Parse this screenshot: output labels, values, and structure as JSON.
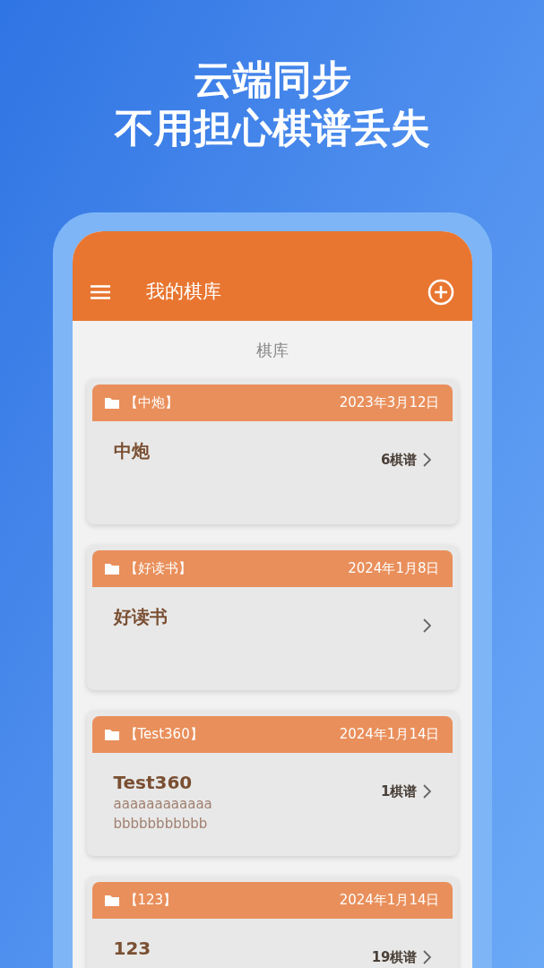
{
  "headline": [
    "云端同步",
    "不用担心棋谱丢失"
  ],
  "app_bar": {
    "title": "我的棋库"
  },
  "section_title": "棋库",
  "folders": [
    {
      "tag": "【中炮】",
      "date": "2023年3月12日",
      "name": "中炮",
      "count": "6棋谱"
    },
    {
      "tag": "【好读书】",
      "date": "2024年1月8日",
      "name": "好读书"
    },
    {
      "tag": "【Test360】",
      "date": "2024年1月14日",
      "name": "Test360",
      "description": [
        "aaaaaaaaaaaa",
        "bbbbbbbbbbb"
      ],
      "count": "1棋谱"
    },
    {
      "tag": "【123】",
      "date": "2024年1月14日",
      "name": "123",
      "count": "19棋谱"
    }
  ]
}
